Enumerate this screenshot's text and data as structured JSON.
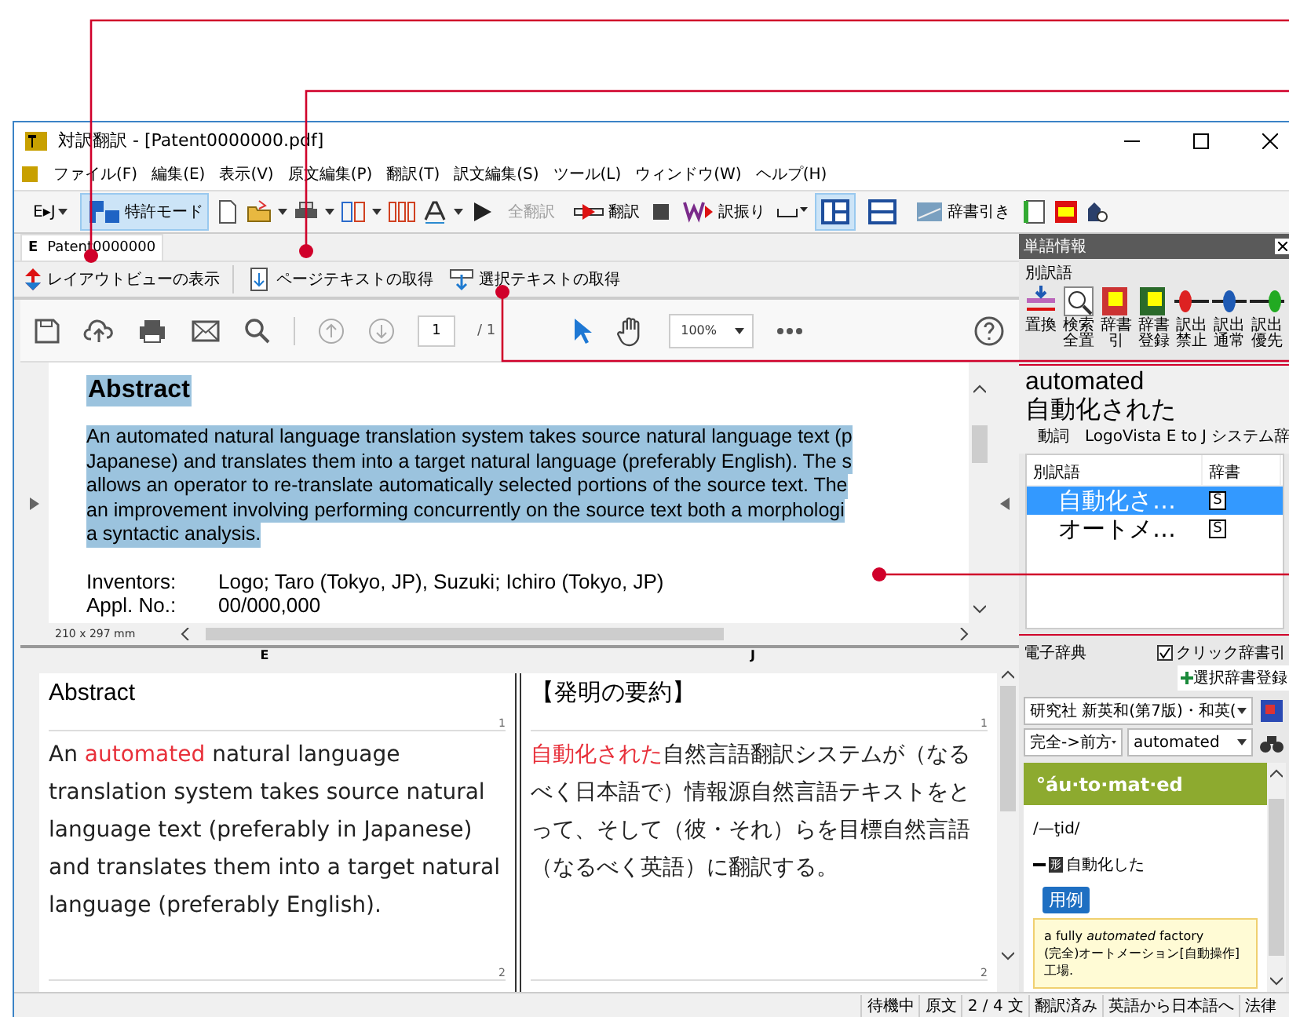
{
  "window": {
    "title": "対訳翻訳 - [Patent0000000.pdf]"
  },
  "menu": [
    "ファイル(F)",
    "編集(E)",
    "表示(V)",
    "原文編集(P)",
    "翻訳(T)",
    "訳文編集(S)",
    "ツール(L)",
    "ウィンドウ(W)",
    "ヘルプ(H)"
  ],
  "toolbar": {
    "direction": "E▸J",
    "patent_mode": {
      "label": "特許モード",
      "selected": true
    },
    "translate_all": {
      "label": "全翻訳",
      "disabled": true
    },
    "translate": {
      "label": "翻訳"
    },
    "furigana": {
      "label": "訳振り"
    },
    "dictionary": {
      "label": "辞書引き"
    },
    "layouts": [
      {
        "selected": true
      },
      {
        "selected": false
      }
    ]
  },
  "tab": {
    "marker": "E",
    "label": "Patent0000000"
  },
  "sub_toolbar": [
    "レイアウトビューの表示",
    "ページテキストの取得",
    "選択テキストの取得"
  ],
  "pdf_toolbar": {
    "page": "1",
    "pages": "/ 1",
    "zoom": "100%"
  },
  "document": {
    "heading": "Abstract",
    "lines": [
      "An automated natural language translation system takes source natural language text (p",
      "Japanese) and translates them into a target natural language (preferably English). The s",
      "allows an operator to re-translate automatically selected portions of the source text. The",
      "an improvement involving performing concurrently on the source text both a morphologi",
      "a syntactic analysis."
    ],
    "fields": [
      {
        "label": "Inventors:",
        "value": "Logo; Taro (Tokyo, JP), Suzuki; Ichiro (Tokyo, JP)"
      },
      {
        "label": "Appl. No.:",
        "value": "00/000,000"
      }
    ],
    "page_size": "210 x 297 mm"
  },
  "bilingual": {
    "columns": [
      "E",
      "J"
    ],
    "source": {
      "title": "Abstract",
      "pre": "An ",
      "highlight": "automated",
      "post": " natural language translation system takes source natural language text (preferably in Japanese) and translates them into a target natural language (preferably English)."
    },
    "target": {
      "title": "【発明の要約】",
      "highlight": "自動化された",
      "post": "自然言語翻訳システムが（なるべく日本語で）情報源自然言語テキストをとって、そして（彼・それ）らを目標自然言語（なるべく英語）に翻訳する。"
    },
    "segments": [
      [
        "1",
        "2"
      ],
      [
        "1",
        "2"
      ]
    ]
  },
  "word_panel": {
    "title": "単語情報",
    "section": "別訳語",
    "tools": [
      "置換",
      "検索全置",
      "辞書引",
      "辞書登録",
      "訳出禁止",
      "訳出通常",
      "訳出優先"
    ],
    "word": "automated",
    "translation": "自動化された",
    "info": "動詞　LogoVista E to J システム辞",
    "columns": [
      "別訳語",
      "辞書"
    ],
    "rows": [
      {
        "text": "自動化さ…",
        "dict": "S",
        "selected": true
      },
      {
        "text": "オートメ…",
        "dict": "S",
        "selected": false
      }
    ]
  },
  "dictionary_panel": {
    "title": "電子辞典",
    "click_lookup": {
      "label": "クリック辞書引",
      "checked": true
    },
    "register": "選択辞書登録",
    "dictionary": "研究社 新英和(第7版)・和英(",
    "match": "完全->前方",
    "query": "automated",
    "headword": "°áu·to·mat·ed",
    "pronunciation": "/—ţid/",
    "pos": "形",
    "sense": "自動化した",
    "example_tag": "用例",
    "example_en": "a fully *automated* factory",
    "example_ja": "(完全)オートメーション[自動操作]工場."
  },
  "status_bar": [
    "待機中",
    "原文",
    "2 / 4 文",
    "翻訳済み",
    "英語から日本語へ",
    "法律"
  ]
}
